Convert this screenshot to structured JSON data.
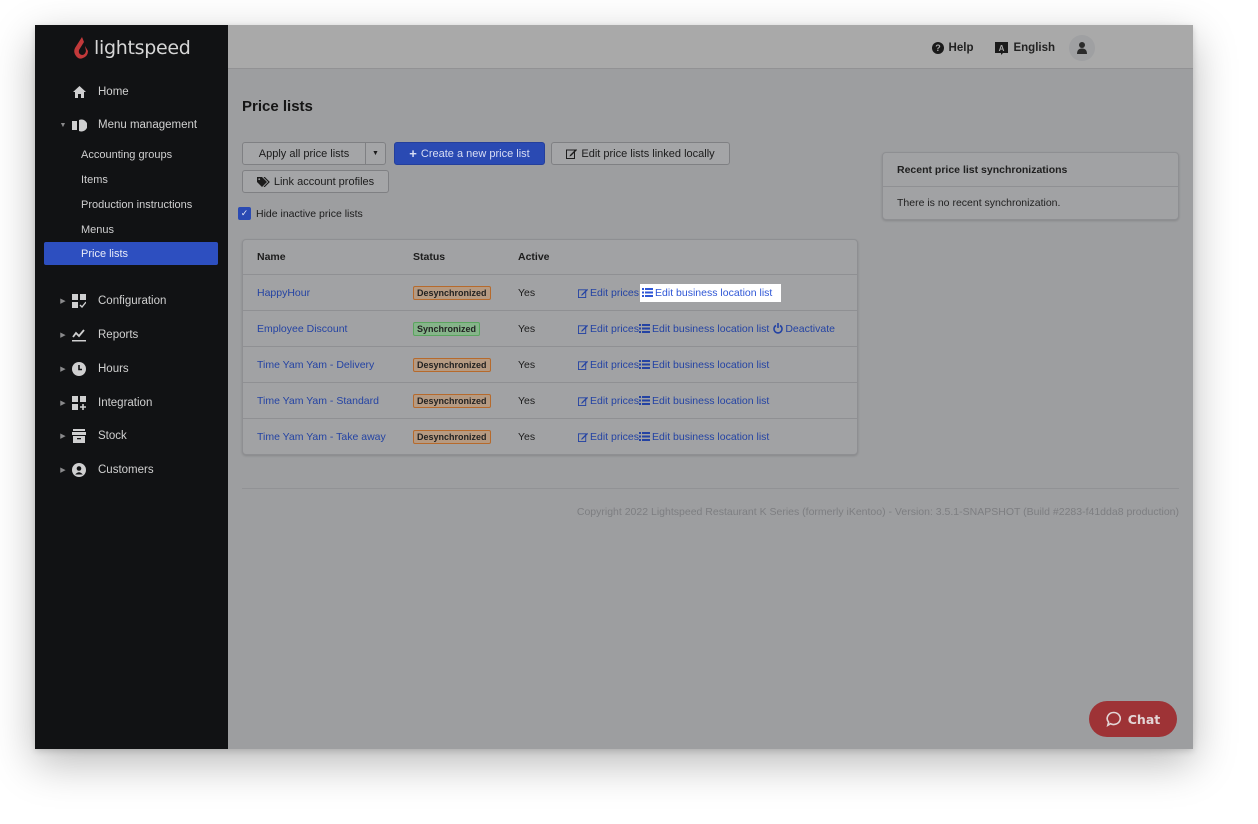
{
  "brand": {
    "name": "lightspeed",
    "logo_color": "#c2393a"
  },
  "topbar": {
    "help_label": "Help",
    "language_label": "English",
    "icons": {
      "help": "question-circle-icon",
      "language": "language-icon",
      "user": "user-icon"
    }
  },
  "sidebar": {
    "home": {
      "label": "Home",
      "icon": "home-icon"
    },
    "menu_management": {
      "label": "Menu management",
      "icon": "menu-management-icon",
      "expanded": true,
      "children": [
        {
          "label": "Accounting groups",
          "active": false
        },
        {
          "label": "Items",
          "active": false
        },
        {
          "label": "Production instructions",
          "active": false
        },
        {
          "label": "Menus",
          "active": false
        },
        {
          "label": "Price lists",
          "active": true
        }
      ]
    },
    "sections": [
      {
        "label": "Configuration",
        "icon": "configuration-icon"
      },
      {
        "label": "Reports",
        "icon": "reports-icon"
      },
      {
        "label": "Hours",
        "icon": "clock-icon"
      },
      {
        "label": "Integration",
        "icon": "integration-icon"
      },
      {
        "label": "Stock",
        "icon": "stock-icon"
      },
      {
        "label": "Customers",
        "icon": "customer-icon"
      }
    ],
    "active_color": "#2d4fc0"
  },
  "main": {
    "title": "Price lists",
    "toolbar": {
      "apply_all_label": "Apply all price lists",
      "create_label": "Create a new price list",
      "edit_linked_label": "Edit price lists linked locally",
      "link_profiles_label": "Link account profiles"
    },
    "hide_inactive": {
      "label": "Hide inactive price lists",
      "checked": true
    },
    "table": {
      "columns": [
        "Name",
        "Status",
        "Active"
      ],
      "rows": [
        {
          "name": "HappyHour",
          "status": "Desynchronized",
          "status_type": "desync",
          "active": "Yes",
          "actions": [
            "Edit prices",
            "Edit business location list"
          ]
        },
        {
          "name": "Employee Discount",
          "status": "Synchronized",
          "status_type": "sync",
          "active": "Yes",
          "actions": [
            "Edit prices",
            "Edit business location list",
            "Deactivate"
          ]
        },
        {
          "name": "Time Yam Yam - Delivery",
          "status": "Desynchronized",
          "status_type": "desync",
          "active": "Yes",
          "actions": [
            "Edit prices",
            "Edit business location list"
          ]
        },
        {
          "name": "Time Yam Yam - Standard",
          "status": "Desynchronized",
          "status_type": "desync",
          "active": "Yes",
          "actions": [
            "Edit prices",
            "Edit business location list"
          ]
        },
        {
          "name": "Time Yam Yam - Take away",
          "status": "Desynchronized",
          "status_type": "desync",
          "active": "Yes",
          "actions": [
            "Edit prices",
            "Edit business location list"
          ]
        }
      ]
    },
    "sync_panel": {
      "title": "Recent price list synchronizations",
      "body": "There is no recent synchronization."
    },
    "footer": "Copyright 2022 Lightspeed Restaurant K Series (formerly iKentoo) - Version: 3.5.1-SNAPSHOT (Build #2283-f41dda8 production)"
  },
  "chat": {
    "label": "Chat",
    "color": "#9e3336"
  }
}
